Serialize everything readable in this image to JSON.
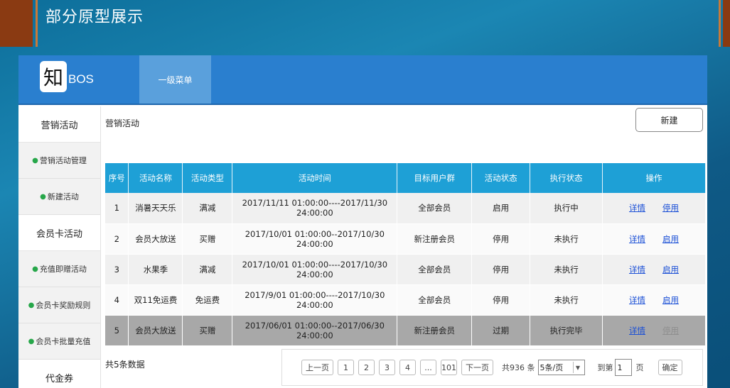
{
  "slide_title": "部分原型展示",
  "header": {
    "logo_char": "知",
    "logo_text": "BOS",
    "menu_tab": "一级菜单"
  },
  "sidebar": [
    {
      "type": "group",
      "label": "营销活动"
    },
    {
      "type": "item",
      "label": "营销活动管理"
    },
    {
      "type": "item",
      "label": "新建活动"
    },
    {
      "type": "group",
      "label": "会员卡活动"
    },
    {
      "type": "item",
      "label": "充值即赠活动"
    },
    {
      "type": "item",
      "label": "会员卡奖励规则"
    },
    {
      "type": "item",
      "label": "会员卡批量充值"
    },
    {
      "type": "group",
      "label": "代金券"
    }
  ],
  "main": {
    "title": "营销活动",
    "new_button": "新建",
    "columns": [
      "序号",
      "活动名称",
      "活动类型",
      "活动时间",
      "目标用户群",
      "活动状态",
      "执行状态",
      "操作"
    ],
    "rows": [
      {
        "no": "1",
        "name": "消暑天天乐",
        "type": "满减",
        "time": "2017/11/11 01:00:00----2017/11/30    24:00:00",
        "target": "全部会员",
        "status": "启用",
        "exec": "执行中",
        "op1": "详情",
        "op2": "停用",
        "style": "odd"
      },
      {
        "no": "2",
        "name": "会员大放送",
        "type": "买赠",
        "time": "2017/10/01 01:00:00--2017/10/30 24:00:00",
        "target": "新注册会员",
        "status": "停用",
        "exec": "未执行",
        "op1": "详情",
        "op2": "启用",
        "style": "even"
      },
      {
        "no": "3",
        "name": "水果季",
        "type": "满减",
        "time": "2017/10/01 01:00:00----2017/10/30    24:00:00",
        "target": "全部会员",
        "status": "停用",
        "exec": "未执行",
        "op1": "详情",
        "op2": "启用",
        "style": "odd"
      },
      {
        "no": "4",
        "name": "双11免运费",
        "type": "免运费",
        "time": "2017/9/01 01:00:00----2017/10/30   24:00:00",
        "target": "全部会员",
        "status": "停用",
        "exec": "未执行",
        "op1": "详情",
        "op2": "启用",
        "style": "even"
      },
      {
        "no": "5",
        "name": "会员大放送",
        "type": "买赠",
        "time": "2017/06/01 01:00:00--2017/06/30 24:00:00",
        "target": "新注册会员",
        "status": "过期",
        "exec": "执行完毕",
        "op1": "详情",
        "op2": "停用",
        "style": "expired"
      }
    ],
    "total_text": "共5条数据",
    "pager": {
      "prev": "上一页",
      "pages": [
        "1",
        "2",
        "3",
        "4",
        "...",
        "101"
      ],
      "next": "下一页",
      "total_label": "共936 条",
      "page_size": "5条/页",
      "goto_prefix": "到第",
      "goto_value": "1",
      "goto_suffix": "页",
      "confirm": "确定"
    }
  }
}
